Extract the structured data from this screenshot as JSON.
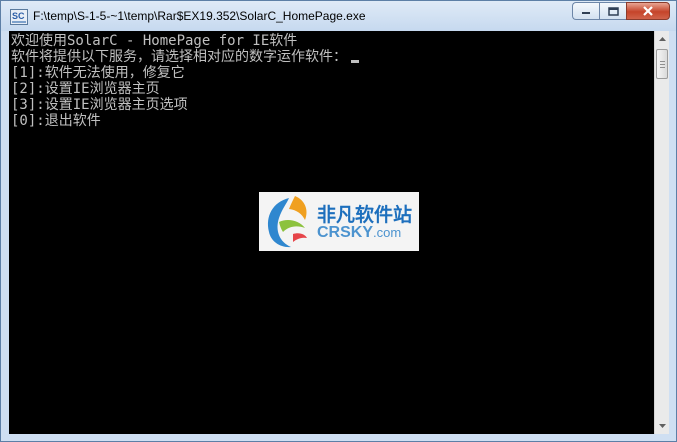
{
  "window": {
    "title": "F:\\temp\\S-1-5-~1\\temp\\Rar$EX19.352\\SolarC_HomePage.exe",
    "icon": "console-app-icon"
  },
  "console": {
    "lines": [
      "欢迎使用SolarC - HomePage for IE软件",
      "软件将提供以下服务，请选择相对应的数字运作软件：",
      "[1]:软件无法使用，修复它",
      "[2]:设置IE浏览器主页",
      "[3]:设置IE浏览器主页选项",
      "[0]:退出软件"
    ]
  },
  "watermark": {
    "name_cn": "非凡软件站",
    "name_en": "CRSKY",
    "domain_suffix": ".com"
  },
  "colors": {
    "console_bg": "#000000",
    "console_text": "#c0c0c0",
    "close_button": "#c5442a",
    "watermark_blue": "#1d6fbd"
  }
}
